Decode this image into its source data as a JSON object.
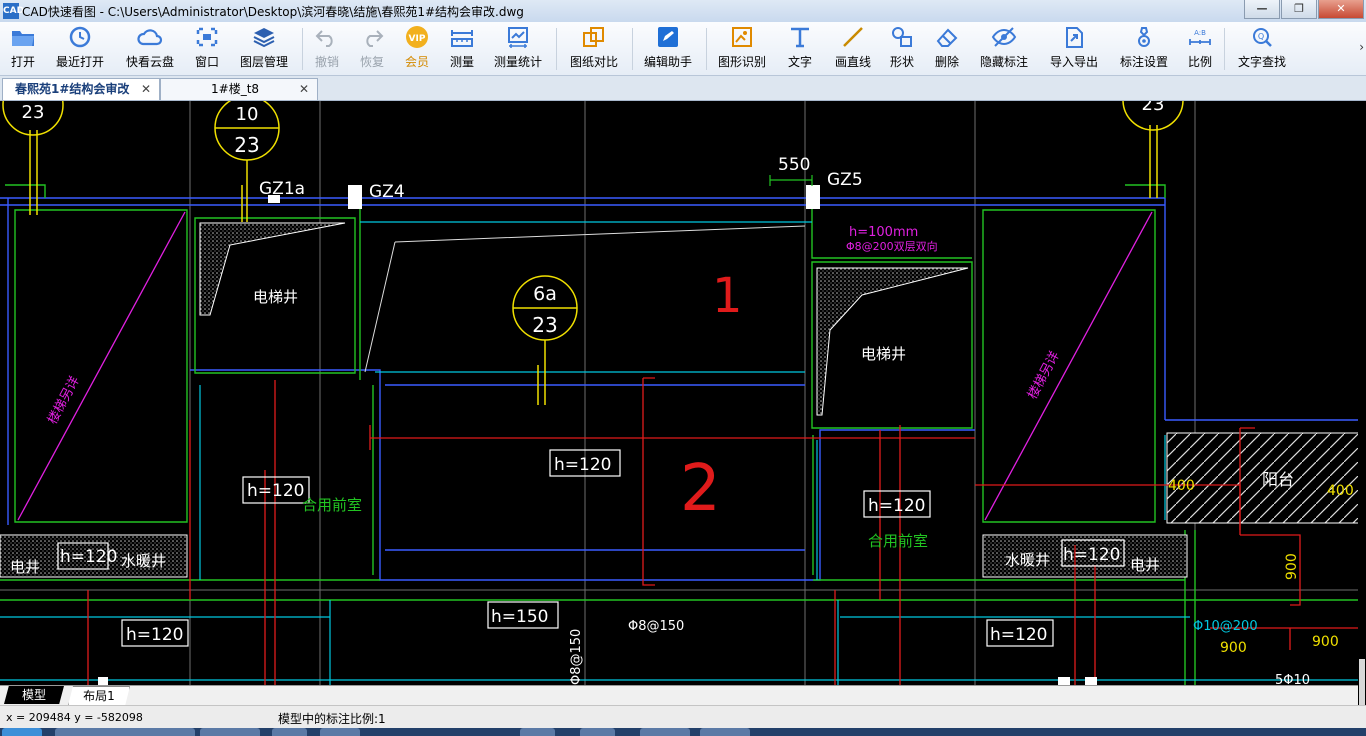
{
  "window": {
    "app_icon_text": "CAD",
    "title": "CAD快速看图 - C:\\Users\\Administrator\\Desktop\\滨河春晓\\结施\\春熙苑1#结构会审改.dwg",
    "buttons": {
      "minimize": "—",
      "maximize": "❐",
      "close": "✕"
    }
  },
  "toolbar": {
    "items": [
      {
        "id": "open",
        "label": "打开",
        "icon": "folder-icon"
      },
      {
        "id": "recent",
        "label": "最近打开",
        "icon": "clock-icon"
      },
      {
        "id": "cloud",
        "label": "快看云盘",
        "icon": "cloud-icon"
      },
      {
        "id": "window",
        "label": "窗口",
        "icon": "window-icon"
      },
      {
        "id": "layers",
        "label": "图层管理",
        "icon": "layers-icon"
      },
      {
        "id": "undo",
        "label": "撤销",
        "icon": "undo-icon",
        "disabled": true
      },
      {
        "id": "redo",
        "label": "恢复",
        "icon": "redo-icon",
        "disabled": true
      },
      {
        "id": "vip",
        "label": "会员",
        "icon": "vip-icon",
        "vip_text": "VIP"
      },
      {
        "id": "measure",
        "label": "测量",
        "icon": "ruler-icon"
      },
      {
        "id": "measure_stats",
        "label": "测量统计",
        "icon": "stats-icon"
      },
      {
        "id": "compare",
        "label": "图纸对比",
        "icon": "compare-icon"
      },
      {
        "id": "edit_helper",
        "label": "编辑助手",
        "icon": "edit-helper-icon"
      },
      {
        "id": "shape_recog",
        "label": "图形识别",
        "icon": "shape-recognition-icon"
      },
      {
        "id": "text",
        "label": "文字",
        "icon": "text-icon"
      },
      {
        "id": "line",
        "label": "画直线",
        "icon": "line-icon"
      },
      {
        "id": "shape",
        "label": "形状",
        "icon": "shape-icon"
      },
      {
        "id": "delete",
        "label": "删除",
        "icon": "eraser-icon"
      },
      {
        "id": "hide_annot",
        "label": "隐藏标注",
        "icon": "eye-hidden-icon"
      },
      {
        "id": "import_export",
        "label": "导入导出",
        "icon": "export-icon"
      },
      {
        "id": "annot_settings",
        "label": "标注设置",
        "icon": "settings-icon"
      },
      {
        "id": "scale",
        "label": "比例",
        "icon": "scale-icon"
      },
      {
        "id": "find_text",
        "label": "文字查找",
        "icon": "find-text-icon"
      }
    ],
    "more": "›"
  },
  "tabs": [
    {
      "label": "春熙苑1#结构会审改",
      "close": "✕",
      "active": true
    },
    {
      "label": "1#楼_t8",
      "close": "✕",
      "active": false
    }
  ],
  "drawing": {
    "texts": {
      "b1_top": "10",
      "b1_bot": "23",
      "b2_top": "6a",
      "b2_bot": "23",
      "b3_partial": "23",
      "b0_partial": "23",
      "gz1a": "GZ1a",
      "gz4": "GZ4",
      "gz5": "GZ5",
      "dim550": "550",
      "elev1": "电梯井",
      "elev2": "电梯井",
      "h100": "h=100mm",
      "rebar200": "Φ8@200双层双向",
      "room1": "1",
      "room2": "2",
      "stair1": "楼梯另详",
      "stair2": "楼梯另详",
      "h120_a": "h=120",
      "h120_b": "h=120",
      "h120_c": "h=120",
      "h120_d": "h=120",
      "h120_e": "h=120",
      "h120_f": "h=120",
      "h120_g": "h=120",
      "h150": "h=150",
      "front1": "合用前室",
      "front2": "合用前室",
      "water1": "水暖井",
      "water2": "水暖井",
      "elec1": "电井",
      "elec2": "电井",
      "balcony": "阳台",
      "d400a": "400",
      "d400b": "400",
      "d900a": "900",
      "d900b": "900",
      "d900c": "900",
      "rebar150": "Φ8@150",
      "rebar150v": "Φ8@150",
      "rebar10_200": "Φ10@200",
      "rebar5_10": "5Φ10"
    },
    "colors": {
      "background": "#000000",
      "green": "#22c322",
      "blue": "#3a5cff",
      "cyan": "#00c8e0",
      "red": "#e01b1b",
      "magenta": "#e020e0",
      "yellow": "#f0e000",
      "white": "#ffffff",
      "gray": "#7f7f7f"
    }
  },
  "layout_tabs": [
    {
      "label": "模型",
      "active": true
    },
    {
      "label": "布局1",
      "active": false
    }
  ],
  "status": {
    "coords": "x = 209484  y = -582098",
    "scale_text": "模型中的标注比例:1"
  }
}
